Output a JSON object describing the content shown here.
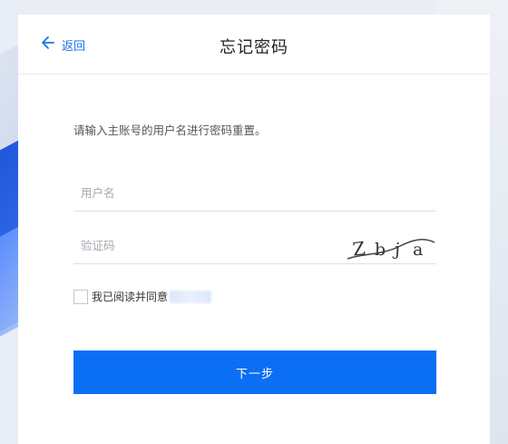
{
  "header": {
    "back_label": "返回",
    "title": "忘记密码"
  },
  "form": {
    "description": "请输入主账号的用户名进行密码重置。",
    "username_placeholder": "用户名",
    "captcha_placeholder": "验证码",
    "captcha_text": "Zbja",
    "agree_label": "我已阅读并同意",
    "submit_label": "下一步"
  },
  "colors": {
    "accent": "#0b6ff5",
    "link": "#1a73e8"
  },
  "icons": {
    "back": "arrow-left-icon"
  }
}
